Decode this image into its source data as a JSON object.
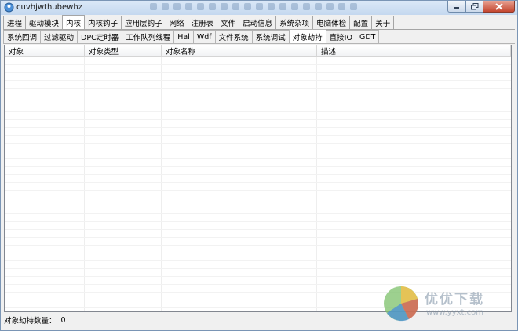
{
  "window": {
    "title": "cuvhjwthubewhz"
  },
  "tabs_main": [
    {
      "label": "进程",
      "name": "tab-process"
    },
    {
      "label": "驱动模块",
      "name": "tab-driver-modules"
    },
    {
      "label": "内核",
      "name": "tab-kernel",
      "active": true
    },
    {
      "label": "内核钩子",
      "name": "tab-kernel-hooks"
    },
    {
      "label": "应用层钩子",
      "name": "tab-app-hooks"
    },
    {
      "label": "网络",
      "name": "tab-network"
    },
    {
      "label": "注册表",
      "name": "tab-registry"
    },
    {
      "label": "文件",
      "name": "tab-file"
    },
    {
      "label": "启动信息",
      "name": "tab-startup"
    },
    {
      "label": "系统杂项",
      "name": "tab-system-misc"
    },
    {
      "label": "电脑体检",
      "name": "tab-pc-checkup"
    },
    {
      "label": "配置",
      "name": "tab-config"
    },
    {
      "label": "关于",
      "name": "tab-about"
    }
  ],
  "tabs_sub": [
    {
      "label": "系统回调",
      "name": "subtab-system-callback"
    },
    {
      "label": "过滤驱动",
      "name": "subtab-filter-driver"
    },
    {
      "label": "DPC定时器",
      "name": "subtab-dpc-timer"
    },
    {
      "label": "工作队列线程",
      "name": "subtab-work-queue"
    },
    {
      "label": "Hal",
      "name": "subtab-hal"
    },
    {
      "label": "Wdf",
      "name": "subtab-wdf"
    },
    {
      "label": "文件系统",
      "name": "subtab-file-system"
    },
    {
      "label": "系统调试",
      "name": "subtab-system-debug"
    },
    {
      "label": "对象劫持",
      "name": "subtab-object-hijack",
      "active": true
    },
    {
      "label": "直接IO",
      "name": "subtab-direct-io"
    },
    {
      "label": "GDT",
      "name": "subtab-gdt"
    }
  ],
  "table": {
    "columns": [
      {
        "label": "对象",
        "name": "col-object"
      },
      {
        "label": "对象类型",
        "name": "col-object-type"
      },
      {
        "label": "对象名称",
        "name": "col-object-name"
      },
      {
        "label": "描述",
        "name": "col-description"
      }
    ],
    "rows": []
  },
  "status": {
    "label": "对象劫持数量：",
    "count": "0"
  },
  "watermark": {
    "text": "优优下载",
    "url": "www.yyxt.com"
  },
  "colors": {
    "titlebar": "#c4d8ef",
    "close_button": "#c4462f",
    "window_bg": "#f0f0f0"
  }
}
